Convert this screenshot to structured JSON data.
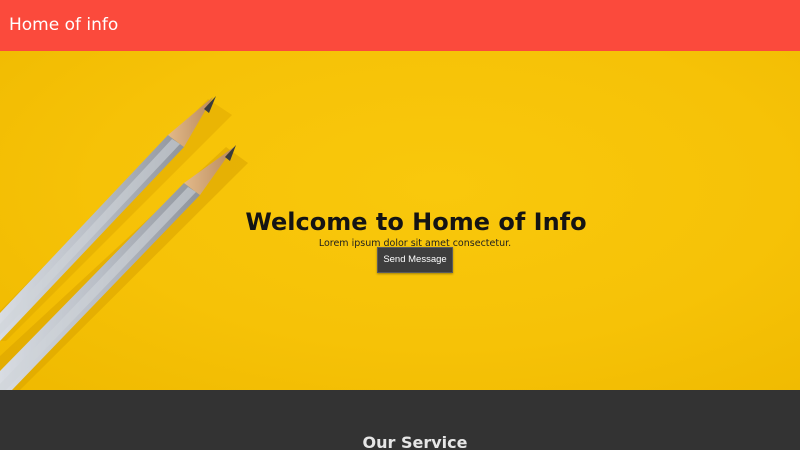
{
  "navbar": {
    "brand": "Home of info",
    "background": "#fb4a3c"
  },
  "hero": {
    "title": "Welcome to Home of Info",
    "subtitle": "Lorem ipsum dolor sit amet consectetur.",
    "button_label": "Send Message",
    "background": "#f6c207",
    "image": "pencils-on-yellow-paper"
  },
  "services": {
    "title": "Our Service",
    "background": "#333333"
  }
}
